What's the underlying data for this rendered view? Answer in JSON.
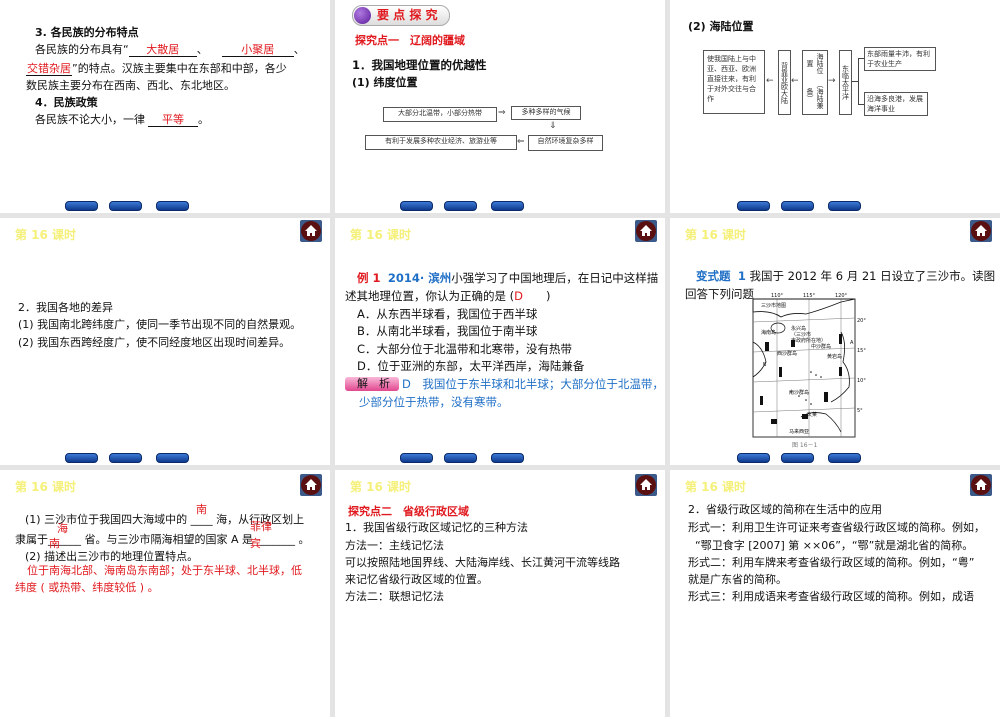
{
  "slide1": {
    "h3": "3. 各民族的分布特点",
    "l1a": "各民族的分布具有“",
    "a1": "大散居",
    "sep": "、",
    "a2": "小聚居",
    "a3": "交错杂居",
    "l2": "”的特点。汉族主要集中在东部和中部，各少",
    "l3": "数民族主要分布在西南、西北、东北地区。",
    "h4": "4．民族政策",
    "l4a": "各民族不论大小，一律",
    "a4": "平等",
    "end": "。"
  },
  "slide2": {
    "badge": "要 点 探 究",
    "point": "探究点一　辽阔的疆域",
    "h1": "1．我国地理位置的优越性",
    "h2": "(1) 纬度位置",
    "box1": "大部分北温带，小部分热带",
    "box2": "多种多样的气候",
    "box3": "自然环境复杂多样",
    "box4": "有利于发展多种农业经济、旅游业等"
  },
  "slide3": {
    "h": "(2) 海陆位置",
    "boxA": "使我国陆上与中亚、西亚、欧洲直接往来，有利于对外交往与合作",
    "boxB": "背靠亚欧大陆",
    "boxC1": "海陆位置",
    "boxC2": "（海陆兼备）",
    "boxD": "东临太平洋",
    "boxE": "东部雨量丰沛，有利于农业生产",
    "boxF": "沿海多良港，发展海洋事业"
  },
  "lesson": "第 16 课时",
  "slide4": {
    "h": "2．我国各地的差异",
    "l1": "(1) 我国南北跨纬度广，使同一季节出现不同的自然景观。",
    "l2": "(2) 我国东西跨经度广，使不同经度地区出现时间差异。"
  },
  "slide5": {
    "ex": "例 1",
    "src": "2014· 滨州",
    "q1": "小强学习了中国地理后，在日记中这样描",
    "q2": "述其地理位置，你认为正确的是 (",
    "ans": "D",
    "q2e": "　　)",
    "A": "A．从东西半球看，我国位于西半球",
    "B": "B．从南北半球看，我国位于南半球",
    "C": "C．大部分位于北温带和北寒带，没有热带",
    "D": "D．位于亚洲的东部，太平洋西岸，海陆兼备",
    "jx": "解　析",
    "e1": "D　我国位于东半球和北半球；大部分位于北温带，",
    "e2": "少部分位于热带，没有寒带。"
  },
  "slide6": {
    "tag": "变式题",
    "num": "1",
    "q1": "我国于 2012 年 6 月 21 日设立了三沙市。读图",
    "q2": "回答下列问题",
    "map": {
      "lon": [
        "110°",
        "115°",
        "120°"
      ],
      "lat": [
        "20°",
        "15°",
        "10°",
        "5°"
      ],
      "title": "三沙市地图",
      "labels": [
        "海南岛",
        "永兴岛",
        "（三沙市",
        "市政府所在地）",
        "中沙群岛",
        "西沙群岛",
        "黄岩岛",
        "南沙群岛",
        "文莱",
        "马来西亚",
        "A",
        "B"
      ]
    },
    "caption": "图 16－1"
  },
  "slide7": {
    "l1": "(1) 三沙市位于我国四大海域中的 ____ 海，从行政区划上",
    "r1": "南",
    "l2": "隶属于______ 省。与三沙市隔海相望的国家 A 是 _______ 。",
    "r2a": "海",
    "r2b": "南",
    "r3a": "菲律",
    "r3b": "宾",
    "l3": "(2) 描述出三沙市的地理位置特点。",
    "a1": "位于南海北部、海南岛东南部；处于东半球、北半球，低",
    "a2": "纬度 ( 或热带、纬度较低 ) 。"
  },
  "slide8": {
    "point": "探究点二　省级行政区域",
    "l1": "1．我国省级行政区域记忆的三种方法",
    "l2": "方法一：主线记忆法",
    "l3": "可以按照陆地国界线、大陆海岸线、长江黄河干流等线路",
    "l4": "来记忆省级行政区域的位置。",
    "l5": "方法二：联想记忆法"
  },
  "slide9": {
    "l1": "2．省级行政区域的简称在生活中的应用",
    "l2": "形式一：利用卫生许可证来考查省级行政区域的简称。例如，",
    "l3": "“鄂卫食字 [2007] 第 ××06”，“鄂”就是湖北省的简称。",
    "l4": "形式二：利用车牌来考查省级行政区域的简称。例如，“粤”",
    "l5": "就是广东省的简称。",
    "l6": "形式三：利用成语来考查省级行政区域的简称。例如，成语"
  }
}
